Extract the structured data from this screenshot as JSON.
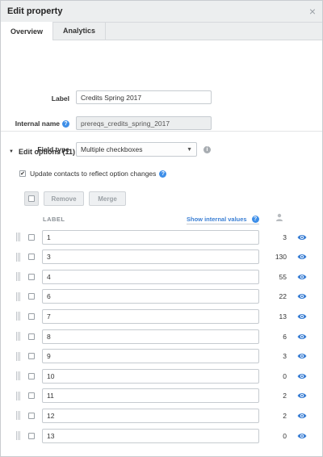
{
  "dialog": {
    "title": "Edit property",
    "close_glyph": "×"
  },
  "tabs": [
    {
      "label": "Overview",
      "active": true
    },
    {
      "label": "Analytics",
      "active": false
    }
  ],
  "form": {
    "label_field": {
      "label": "Label",
      "value": "Credits Spring 2017"
    },
    "internal_name_field": {
      "label": "Internal name",
      "value": "prereqs_credits_spring_2017",
      "help_icon": "help-icon"
    },
    "field_type": {
      "label": "Field type",
      "selected": "Multiple checkboxes",
      "info_icon": "info-icon"
    }
  },
  "edit_options": {
    "heading": "Edit options (11)",
    "update_contacts": {
      "label": "Update contacts to reflect option changes",
      "checked": true
    },
    "toolbar": {
      "remove_label": "Remove",
      "merge_label": "Merge"
    },
    "column_label": "LABEL",
    "show_internal_label": "Show internal values",
    "count_column_icon": "user-icon",
    "options": [
      {
        "label": "1",
        "count": "3"
      },
      {
        "label": "3",
        "count": "130"
      },
      {
        "label": "4",
        "count": "55"
      },
      {
        "label": "6",
        "count": "22"
      },
      {
        "label": "7",
        "count": "13"
      },
      {
        "label": "8",
        "count": "6"
      },
      {
        "label": "9",
        "count": "3"
      },
      {
        "label": "10",
        "count": "0"
      },
      {
        "label": "11",
        "count": "2"
      },
      {
        "label": "12",
        "count": "2"
      },
      {
        "label": "13",
        "count": "0"
      }
    ]
  },
  "colors": {
    "accent_blue": "#3b7fd4",
    "help_blue": "#3d8ee8",
    "header_bg": "#eceeef"
  }
}
